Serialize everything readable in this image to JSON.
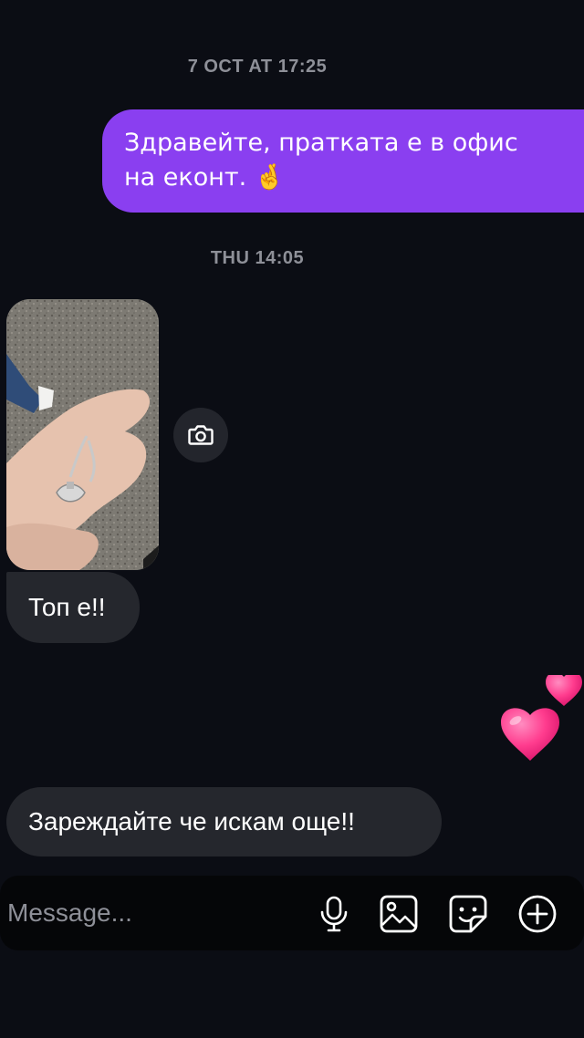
{
  "conversation": {
    "timestamps": [
      "7 OCT AT 17:25",
      "THU 14:05"
    ],
    "outgoing_message": {
      "line1": "Здравейте, пратката е в офис",
      "line2": "на еконт.",
      "emoji": "🤞"
    },
    "incoming_messages": [
      "Топ е!!",
      "Зареждайте че искам още!!"
    ],
    "reaction_emoji": "hearts"
  },
  "photo": {
    "description_icon": "photo-thumbnail"
  },
  "composer": {
    "placeholder": "Message...",
    "icons": [
      "microphone-icon",
      "gallery-icon",
      "sticker-icon",
      "plus-icon"
    ]
  },
  "colors": {
    "background": "#0b0d14",
    "outgoing_bubble": "#8a3ff0",
    "incoming_bubble": "#25272d",
    "timestamp": "#8e9098",
    "heart": "#ff3c8e"
  }
}
